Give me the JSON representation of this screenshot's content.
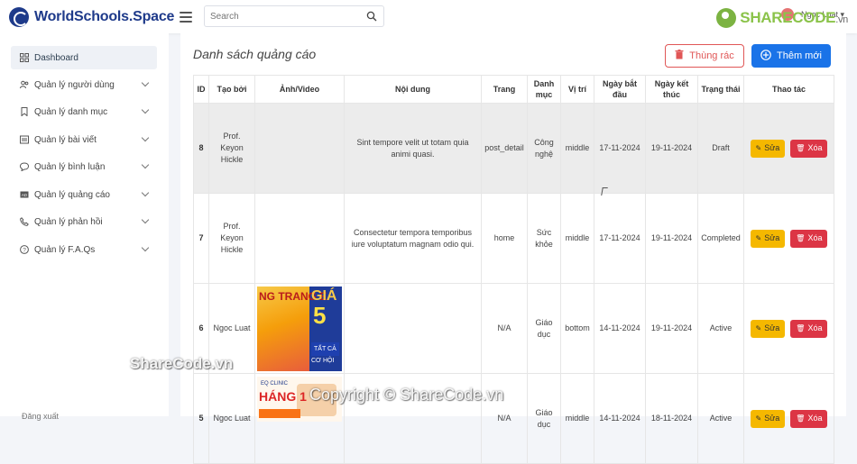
{
  "header": {
    "logo_text": "WorldSchools.Space",
    "search_placeholder": "Search",
    "user_name": "Ngoc Luat ▾",
    "watermark_brand": "SHARECODE",
    "watermark_tld": ".vn"
  },
  "sidebar": {
    "items": [
      {
        "label": "Dashboard",
        "icon": "grid-icon"
      },
      {
        "label": "Quản lý người dùng",
        "icon": "users-icon"
      },
      {
        "label": "Quản lý danh mục",
        "icon": "bookmark-icon"
      },
      {
        "label": "Quản lý bài viết",
        "icon": "article-icon"
      },
      {
        "label": "Quản lý bình luận",
        "icon": "comment-icon"
      },
      {
        "label": "Quản lý quảng cáo",
        "icon": "ad-icon"
      },
      {
        "label": "Quản lý phản hồi",
        "icon": "phone-icon"
      },
      {
        "label": "Quản lý F.A.Qs",
        "icon": "question-icon"
      }
    ],
    "bottom_label": "Đăng xuất"
  },
  "main": {
    "title": "Danh sách quảng cáo",
    "trash_button": "Thùng rác",
    "add_button": "Thêm mới",
    "columns": [
      "ID",
      "Tạo bởi",
      "Ảnh/Video",
      "Nội dung",
      "Trang",
      "Danh mục",
      "Vị trí",
      "Ngày bắt đầu",
      "Ngày kết thúc",
      "Trạng thái",
      "Thao tác"
    ],
    "edit_label": "Sửa",
    "delete_label": "Xóa",
    "rows": [
      {
        "id": "8",
        "creator": "Prof. Keyon Hickle",
        "media": "",
        "content": "Sint tempore velit ut totam quia animi quasi.",
        "page": "post_detail",
        "category": "Công nghệ",
        "position": "middle",
        "start": "17-11-2024",
        "end": "19-11-2024",
        "status": "Draft"
      },
      {
        "id": "7",
        "creator": "Prof. Keyon Hickle",
        "media": "",
        "content": "Consectetur tempora temporibus iure voluptatum magnam odio qui.",
        "page": "home",
        "category": "Sức khỏe",
        "position": "middle",
        "start": "17-11-2024",
        "end": "19-11-2024",
        "status": "Completed"
      },
      {
        "id": "6",
        "creator": "Ngoc Luat",
        "media": "image",
        "content": "",
        "page": "N/A",
        "category": "Giáo dục",
        "position": "bottom",
        "start": "14-11-2024",
        "end": "19-11-2024",
        "status": "Active"
      },
      {
        "id": "5",
        "creator": "Ngoc Luat",
        "media": "image",
        "content": "",
        "page": "N/A",
        "category": "Giáo dục",
        "position": "middle",
        "start": "14-11-2024",
        "end": "18-11-2024",
        "status": "Active"
      }
    ],
    "ad_image_1": {
      "left_text": "NG TRANG E",
      "big1": "GIÁ",
      "big2": "5",
      "tag": "TẤT CẢ",
      "foot": "CƠ HỘI"
    },
    "ad_image_2": {
      "top": "EQ CLINIC",
      "big": "HÁNG 1"
    }
  },
  "watermarks": {
    "left": "ShareCode.vn",
    "center": "Copyright © ShareCode.vn"
  }
}
